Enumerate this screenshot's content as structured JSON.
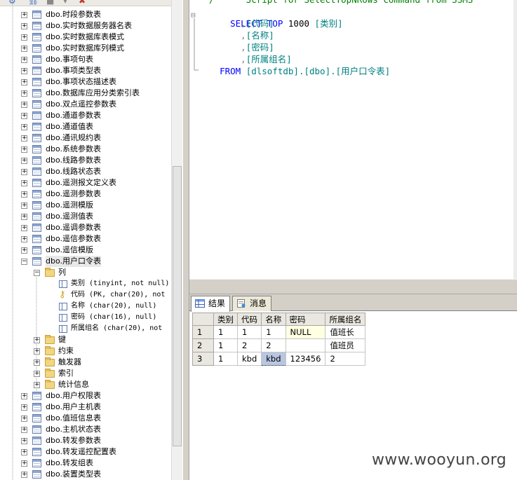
{
  "explorer": {
    "nodes_top": [
      {
        "label": "dbo.时段参数表"
      },
      {
        "label": "dbo.实时数据服务器名表"
      },
      {
        "label": "dbo.实时数据库表模式"
      },
      {
        "label": "dbo.实时数据库列模式"
      },
      {
        "label": "dbo.事项句表"
      },
      {
        "label": "dbo.事项类型表"
      },
      {
        "label": "dbo.事项状态描述表"
      },
      {
        "label": "dbo.数据库应用分类索引表"
      },
      {
        "label": "dbo.双点遥控参数表"
      },
      {
        "label": "dbo.通道参数表"
      },
      {
        "label": "dbo.通道值表"
      },
      {
        "label": "dbo.通讯规约表"
      },
      {
        "label": "dbo.系统参数表"
      },
      {
        "label": "dbo.线路参数表"
      },
      {
        "label": "dbo.线路状态表"
      },
      {
        "label": "dbo.遥测报文定义表"
      },
      {
        "label": "dbo.遥测参数表"
      },
      {
        "label": "dbo.遥测模版"
      },
      {
        "label": "dbo.遥测值表"
      },
      {
        "label": "dbo.遥调参数表"
      },
      {
        "label": "dbo.遥信参数表"
      },
      {
        "label": "dbo.遥信模版"
      }
    ],
    "expanded_table": "dbo.用户口令表",
    "columns_folder": "列",
    "columns": [
      {
        "label": "类别 (tinyint, not null)",
        "icon": "column-icon"
      },
      {
        "label": "代码 (PK, char(20), not",
        "icon": "key-icon"
      },
      {
        "label": "名称 (char(20), null)",
        "icon": "column-icon"
      },
      {
        "label": "密码 (char(16), null)",
        "icon": "column-icon"
      },
      {
        "label": "所属组名 (char(20), not",
        "icon": "column-icon"
      }
    ],
    "folders": [
      {
        "label": "键"
      },
      {
        "label": "约束"
      },
      {
        "label": "触发器"
      },
      {
        "label": "索引"
      },
      {
        "label": "统计信息"
      }
    ],
    "nodes_bottom": [
      {
        "label": "dbo.用户权限表"
      },
      {
        "label": "dbo.用户主机表"
      },
      {
        "label": "dbo.值班信息表"
      },
      {
        "label": "dbo.主机状态表"
      },
      {
        "label": "dbo.转发参数表"
      },
      {
        "label": "dbo.转发遥控配置表"
      },
      {
        "label": "dbo.转发组表"
      },
      {
        "label": "dbo.装置类型表"
      }
    ]
  },
  "editor": {
    "comment_line": "/      Script for SelectTopNRows command from SSMS",
    "select_kw": "SELECT",
    "top_kw": "TOP",
    "top_n": "1000",
    "col1": "[类别]",
    "col2": "[代码]",
    "col3": "[名称]",
    "col4": "[密码]",
    "col5": "[所属组名]",
    "from_kw": "FROM",
    "from_target": "[dlsoftdb].[dbo].[用户口令表]"
  },
  "results": {
    "tab_results": "结果",
    "tab_messages": "消息",
    "headers": [
      "类别",
      "代码",
      "名称",
      "密码",
      "所属组名"
    ],
    "rows": [
      {
        "num": "1",
        "cells": [
          "1",
          "1",
          "1",
          "NULL",
          "值班长"
        ]
      },
      {
        "num": "2",
        "cells": [
          "1",
          "2",
          "2",
          "",
          "值班员"
        ]
      },
      {
        "num": "3",
        "cells": [
          "1",
          "kbd",
          "kbd",
          "123456",
          "2"
        ]
      }
    ]
  },
  "watermark": "www.wooyun.org",
  "colors": {
    "keyword": "#0000ff",
    "identifier": "#008080",
    "comment": "#008000",
    "null_cell": "#ffffe1",
    "selected_cell": "#b8c6e2"
  }
}
